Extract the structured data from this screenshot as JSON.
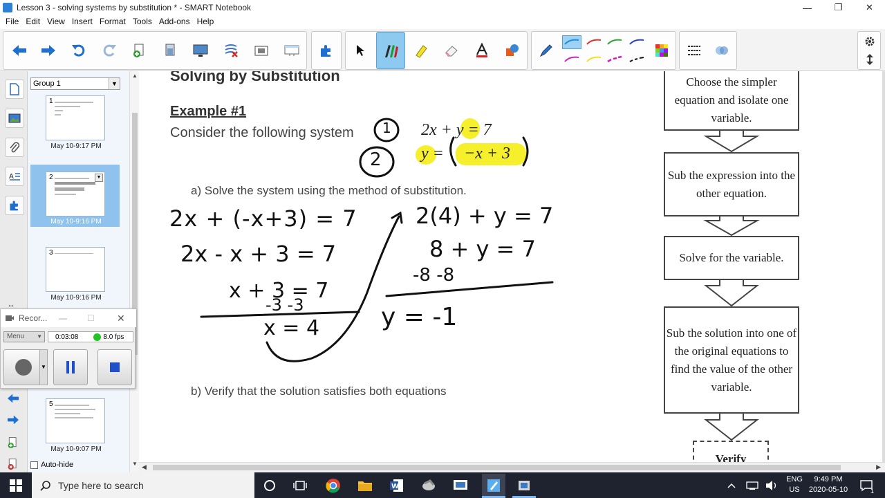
{
  "window": {
    "title": "Lesson 3 - solving systems by substitution * - SMART Notebook",
    "minimize": "—",
    "restore": "❐",
    "close": "✕"
  },
  "menu": [
    "File",
    "Edit",
    "View",
    "Insert",
    "Format",
    "Tools",
    "Add-ons",
    "Help"
  ],
  "toolbar": {
    "icons": [
      "back-icon",
      "forward-icon",
      "undo-icon",
      "redo-icon",
      "add-page-icon",
      "delete-page-icon",
      "screen-shade-icon",
      "clear-ink-icon",
      "capture-icon",
      "table-icon",
      "add-ons-icon",
      "select-icon",
      "pens-icon",
      "highlighter-icon",
      "eraser-icon",
      "text-icon",
      "shapes-icon",
      "pen-style-icon",
      "fill-color-icon",
      "line-style-icon",
      "settings-icon",
      "move-toolbar-icon"
    ],
    "pen_colors": [
      "#1a8fd8",
      "#e0302c",
      "#2fa32f",
      "#2b3fc9",
      "#c426c4",
      "#f2e02a",
      "#d01fb8",
      "#111111"
    ]
  },
  "sorter": {
    "group": "Group 1",
    "pages": [
      {
        "num": "1",
        "date": "May 10-9:17 PM"
      },
      {
        "num": "2",
        "date": "May 10-9:16 PM"
      },
      {
        "num": "3",
        "date": "May 10-9:16 PM"
      },
      {
        "num": "5",
        "date": "May 10-9:07 PM"
      }
    ],
    "autohide": "Auto-hide"
  },
  "recorder": {
    "title": "Recor...",
    "menu": "Menu",
    "time": "0:03:08",
    "fps": "8.0 fps",
    "status_color": "#22c422"
  },
  "page": {
    "heading": "Solving by Substitution",
    "example": "Example #1",
    "intro": "Consider the following system",
    "eq1": "2x + y = 7",
    "eq2_lhs": "y =",
    "eq2_rhs": "−x + 3",
    "qa": "a)   Solve the system using the method of substitution.",
    "qb": "b)   Verify that the solution satisfies both equations",
    "flow": [
      "Choose the simpler equation and isolate one variable.",
      "Sub the expression into the other equation.",
      "Solve for the variable.",
      "Sub the solution into one of the original equations to find the value of the other variable.",
      "Verify"
    ],
    "ink_left": [
      "2x + (-x+3) = 7",
      "2x - x + 3 = 7",
      "x + 3 = 7",
      "-3   -3",
      "x = 4"
    ],
    "ink_right": [
      "2(4) + y = 7",
      "8 + y = 7",
      "-8      -8",
      "y = -1"
    ],
    "ink_circles": [
      "1",
      "2"
    ]
  },
  "taskbar": {
    "search": "Type here to search",
    "lang": "ENG",
    "region": "US",
    "time": "9:49 PM",
    "date": "2020-05-10",
    "notifications": "1"
  }
}
